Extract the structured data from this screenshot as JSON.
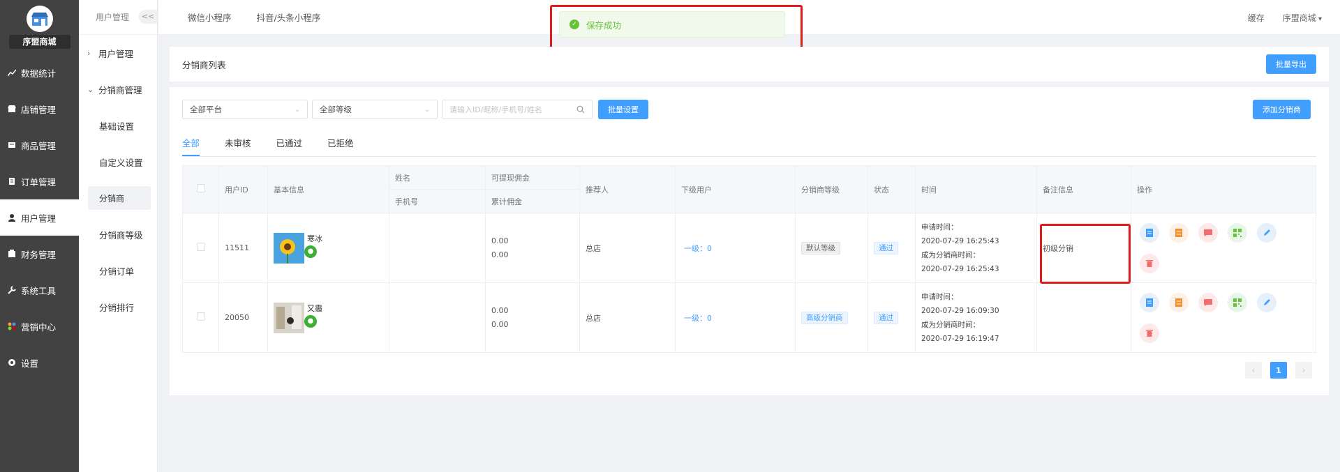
{
  "sidebar": {
    "shop_name": "序盟商城",
    "items": [
      {
        "label": "数据统计",
        "icon": "chart-icon"
      },
      {
        "label": "店铺管理",
        "icon": "store-icon"
      },
      {
        "label": "商品管理",
        "icon": "goods-icon"
      },
      {
        "label": "订单管理",
        "icon": "order-icon"
      },
      {
        "label": "用户管理",
        "icon": "user-icon",
        "active": true
      },
      {
        "label": "财务管理",
        "icon": "finance-icon"
      },
      {
        "label": "系统工具",
        "icon": "wrench-icon"
      },
      {
        "label": "营销中心",
        "icon": "marketing-icon"
      },
      {
        "label": "设置",
        "icon": "gear-icon"
      }
    ]
  },
  "subsidebar": {
    "title": "用户管理",
    "collapse": "<<",
    "groups": [
      {
        "label": "用户管理",
        "expanded": false
      },
      {
        "label": "分销商管理",
        "expanded": true
      }
    ],
    "items": [
      "基础设置",
      "自定义设置",
      "分销商",
      "分销商等级",
      "分销订单",
      "分销排行"
    ],
    "active_item": "分销商"
  },
  "topbar": {
    "tabs": [
      "微信小程序",
      "抖音/头条小程序"
    ],
    "cache": "缓存",
    "user": "序盟商城"
  },
  "toast": {
    "message": "保存成功",
    "color": "#67c23a"
  },
  "page": {
    "title": "分销商列表",
    "export_btn": "批量导出",
    "add_btn": "添加分销商",
    "batch_btn": "批量设置",
    "platform_select": "全部平台",
    "level_select": "全部等级",
    "search_placeholder": "请输入ID/昵称/手机号/姓名",
    "tabs": [
      "全部",
      "未审核",
      "已通过",
      "已拒绝"
    ],
    "active_tab": "全部"
  },
  "table": {
    "headers": {
      "user_id": "用户ID",
      "basic": "基本信息",
      "name": "姓名",
      "phone": "手机号",
      "withdrawable": "可提现佣金",
      "total": "累计佣金",
      "referrer": "推荐人",
      "subordinates": "下级用户",
      "level": "分销商等级",
      "status": "状态",
      "time": "时间",
      "remark": "备注信息",
      "ops": "操作"
    },
    "rows": [
      {
        "user_id": "11511",
        "nickname": "寒冰",
        "name": "",
        "phone": "",
        "withdrawable": "0.00",
        "total": "0.00",
        "referrer": "总店",
        "subordinates": "一级：0",
        "level": "默认等级",
        "level_style": "grey",
        "status": "通过",
        "apply_label": "申请时间：",
        "apply_time": "2020-07-29 16:25:43",
        "become_label": "成为分销商时间：",
        "become_time": "2020-07-29 16:25:43",
        "remark": "初级分销"
      },
      {
        "user_id": "20050",
        "nickname": "又霾",
        "name": "",
        "phone": "",
        "withdrawable": "0.00",
        "total": "0.00",
        "referrer": "总店",
        "subordinates": "一级：0",
        "level": "高级分销商",
        "level_style": "blue",
        "status": "通过",
        "apply_label": "申请时间：",
        "apply_time": "2020-07-29 16:09:30",
        "become_label": "成为分销商时间：",
        "become_time": "2020-07-29 16:19:47",
        "remark": ""
      }
    ]
  },
  "pager": {
    "current": "1",
    "prev": "‹",
    "next": "›"
  },
  "colors": {
    "primary": "#409eff",
    "sidebar": "#424242",
    "highlight": "#e01b1b"
  }
}
